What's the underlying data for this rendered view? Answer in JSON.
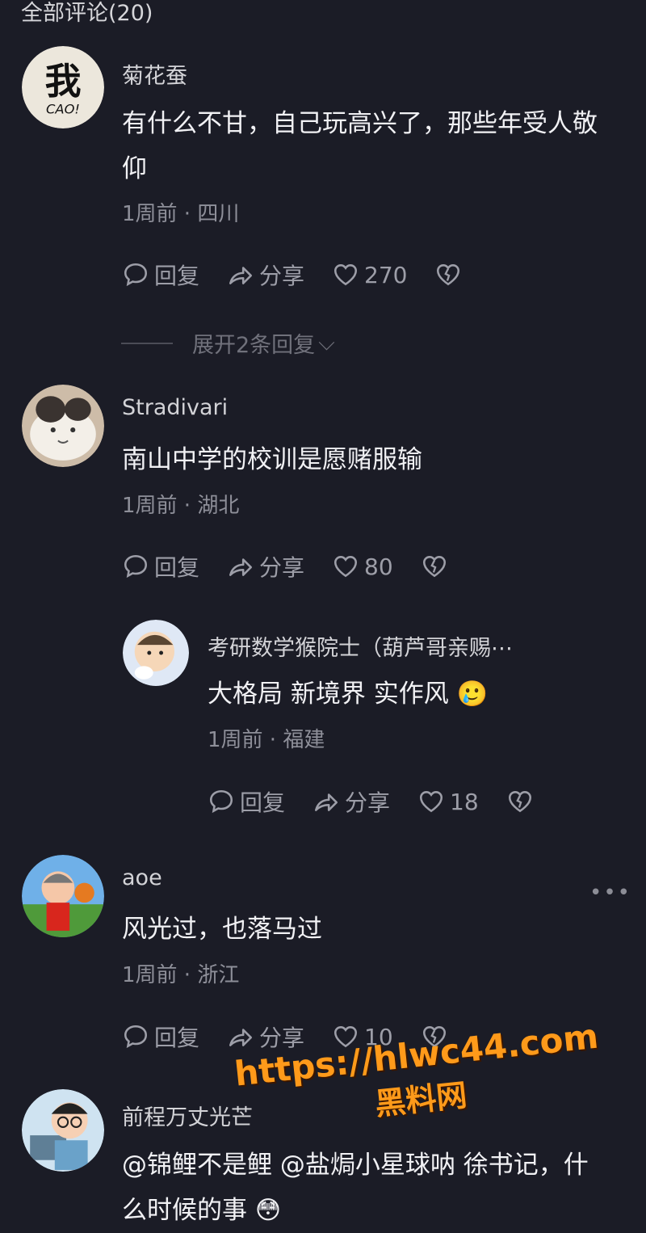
{
  "header": {
    "title": "全部评论(20)"
  },
  "comments": [
    {
      "user": "菊花蚕",
      "avatar": "avatar-wo-calligraphy",
      "text1": "有什么不甘，自己玩高兴了，那些年受人敬",
      "text2": "仰",
      "meta": "1周前 · 四川",
      "reply": "回复",
      "share": "分享",
      "likes": "270"
    },
    {
      "user": "Stradivari",
      "avatar": "avatar-cat",
      "text1": "南山中学的校训是愿赌服输",
      "meta": "1周前 · 湖北",
      "reply": "回复",
      "share": "分享",
      "likes": "80"
    },
    {
      "user": "考研数学猴院士（葫芦哥亲赐⋯",
      "avatar": "avatar-cartoon-kid",
      "text1": "大格局 新境界 实作风 🥲",
      "meta": "1周前 · 福建",
      "reply": "回复",
      "share": "分享",
      "likes": "18"
    },
    {
      "user": "aoe",
      "avatar": "avatar-cartoon-pig",
      "text1": "风光过，也落马过",
      "meta": "1周前 · 浙江",
      "reply": "回复",
      "share": "分享",
      "likes": "10"
    },
    {
      "user": "前程万丈光芒",
      "avatar": "avatar-boy-glasses",
      "text1": "@锦鲤不是鲤  @盐焗小星球呐 徐书记，什",
      "text2": "么时候的事 😳"
    }
  ],
  "expand_replies": "展开2条回复",
  "more_icon": "more-dots-icon",
  "watermark": {
    "url": "https://hlwc44.com",
    "cn": "黑料网"
  },
  "colors": {
    "background": "#1b1c26",
    "accent_watermark": "#ff9a1a"
  }
}
